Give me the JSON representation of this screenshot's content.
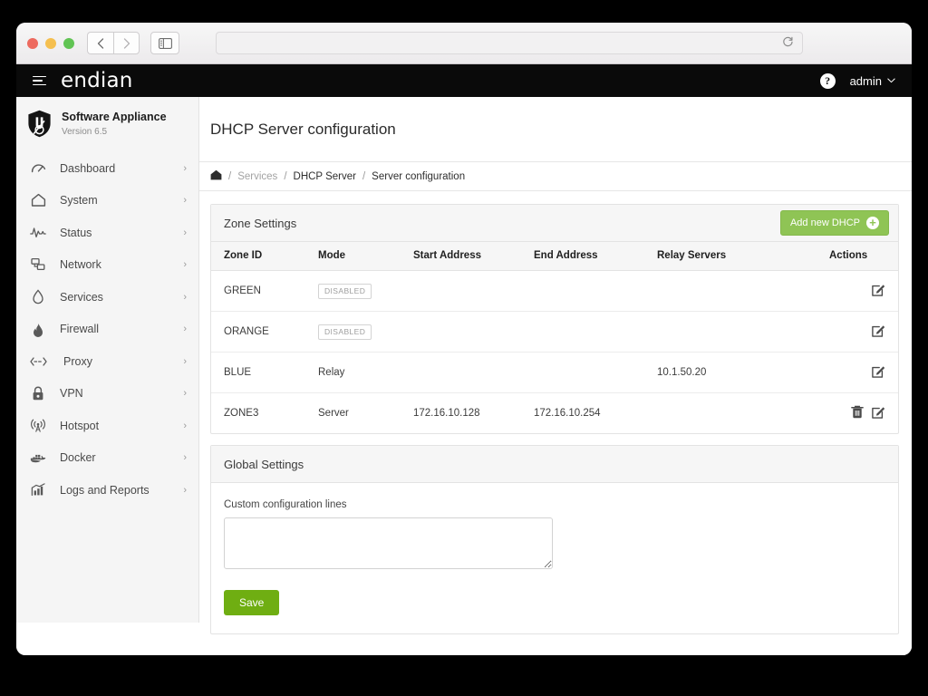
{
  "browser": {
    "back_label": "‹",
    "forward_label": "›",
    "sidebar_toggle_label": "sidebar-toggle",
    "address_value": "",
    "address_placeholder": "",
    "reload_label": "↻"
  },
  "topbar": {
    "brand": "endian",
    "menu_label": "menu",
    "help_label": "?",
    "user_label": "admin",
    "caret": "⌄"
  },
  "sidebar": {
    "appliance_name": "Software Appliance",
    "appliance_version": "Version 6.5",
    "chevron": "›",
    "items": [
      {
        "label": "Dashboard",
        "icon": "gauge-icon"
      },
      {
        "label": "System",
        "icon": "home-icon"
      },
      {
        "label": "Status",
        "icon": "pulse-icon"
      },
      {
        "label": "Network",
        "icon": "network-icon"
      },
      {
        "label": "Services",
        "icon": "droplet-icon"
      },
      {
        "label": "Firewall",
        "icon": "flame-icon"
      },
      {
        "label": "Proxy",
        "icon": "arrows-icon"
      },
      {
        "label": "VPN",
        "icon": "lock-icon"
      },
      {
        "label": "Hotspot",
        "icon": "antenna-icon"
      },
      {
        "label": "Docker",
        "icon": "docker-icon"
      },
      {
        "label": "Logs and Reports",
        "icon": "chart-icon"
      }
    ]
  },
  "main": {
    "page_title": "DHCP Server configuration",
    "breadcrumb": {
      "home": "⌂",
      "separator": "/",
      "items": [
        "Services",
        "DHCP Server",
        "Server configuration"
      ]
    },
    "zone_settings": {
      "title": "Zone Settings",
      "add_button": "Add new DHCP",
      "add_button_color": "#8fc455",
      "columns": [
        "Zone ID",
        "Mode",
        "Start Address",
        "End Address",
        "Relay Servers",
        "Actions"
      ],
      "rows": [
        {
          "zone_id": "GREEN",
          "mode": "DISABLED",
          "mode_is_badge": true,
          "start_address": "",
          "end_address": "",
          "relay_servers": "",
          "actions": [
            "edit-icon"
          ]
        },
        {
          "zone_id": "ORANGE",
          "mode": "DISABLED",
          "mode_is_badge": true,
          "start_address": "",
          "end_address": "",
          "relay_servers": "",
          "actions": [
            "edit-icon"
          ]
        },
        {
          "zone_id": "BLUE",
          "mode": "Relay",
          "mode_is_badge": false,
          "start_address": "",
          "end_address": "",
          "relay_servers": "10.1.50.20",
          "actions": [
            "edit-icon"
          ]
        },
        {
          "zone_id": "ZONE3",
          "mode": "Server",
          "mode_is_badge": false,
          "start_address": "172.16.10.128",
          "end_address": "172.16.10.254",
          "relay_servers": "",
          "actions": [
            "trash-icon",
            "edit-icon"
          ]
        }
      ]
    },
    "global_settings": {
      "title": "Global Settings",
      "custom_lines_label": "Custom configuration lines",
      "custom_lines_value": "",
      "custom_lines_placeholder": "",
      "save_button": "Save",
      "save_button_color": "#6fae12"
    }
  }
}
